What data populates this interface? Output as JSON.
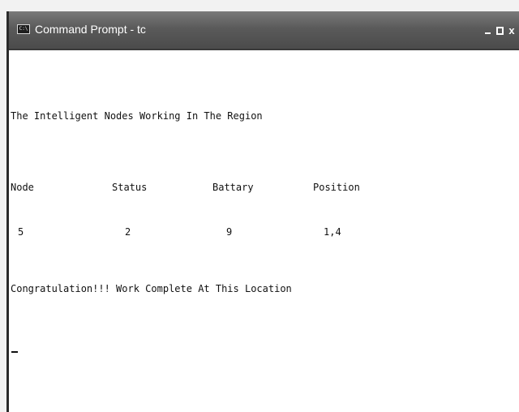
{
  "window": {
    "title": "Command Prompt - tc",
    "icon_label": "C:\\",
    "close_glyph": "x"
  },
  "console": {
    "heading": "The Intelligent Nodes Working In The Region",
    "columns": [
      "Node",
      "Status",
      "Battary",
      "Position"
    ],
    "values": [
      "5",
      "2",
      "9",
      "1,4"
    ],
    "message": "Congratulation!!! Work Complete At This Location"
  }
}
